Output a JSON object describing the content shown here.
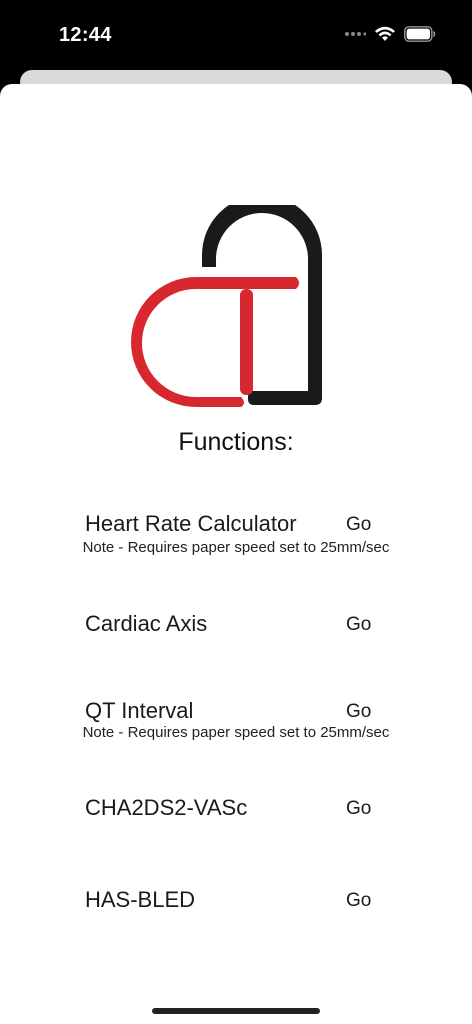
{
  "status_bar": {
    "time": "12:44",
    "icons": [
      "cellular-dots-icon",
      "wifi-icon",
      "battery-icon"
    ]
  },
  "logo": {
    "colors": {
      "red": "#d8282f",
      "black": "#1a1a1a"
    }
  },
  "title": "Functions:",
  "functions": [
    {
      "label": "Heart Rate Calculator",
      "go": "Go",
      "note": "Note - Requires paper speed set to 25mm/sec"
    },
    {
      "label": "Cardiac Axis",
      "go": "Go"
    },
    {
      "label": "QT Interval",
      "go": "Go",
      "note": "Note - Requires paper speed set to 25mm/sec"
    },
    {
      "label": "CHA2DS2-VASc",
      "go": "Go"
    },
    {
      "label": "HAS-BLED",
      "go": "Go"
    }
  ]
}
